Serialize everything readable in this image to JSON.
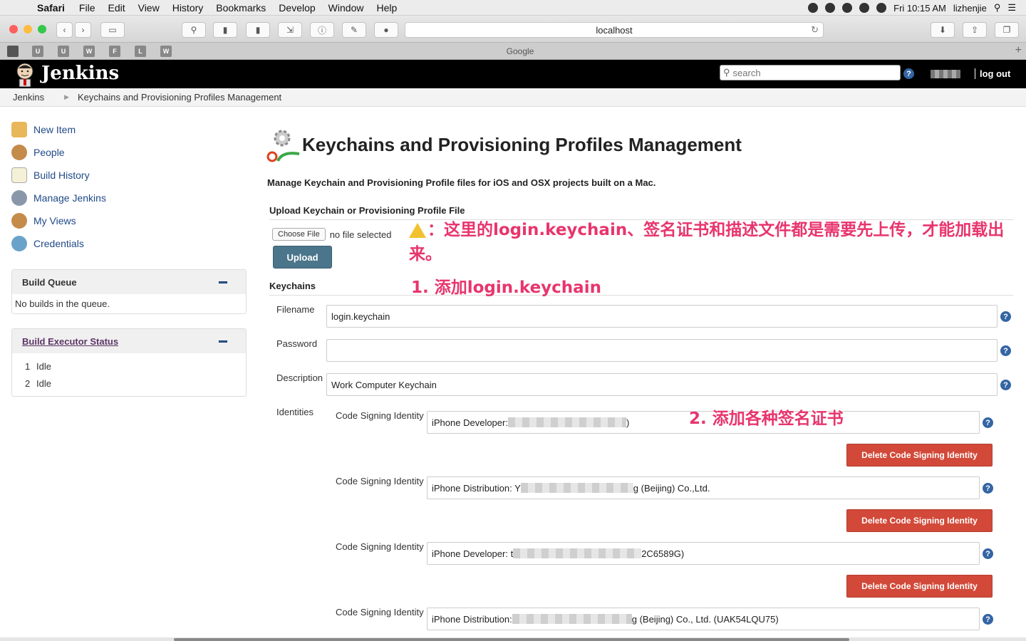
{
  "menubar": {
    "app": "Safari",
    "items": [
      "File",
      "Edit",
      "View",
      "History",
      "Bookmarks",
      "Develop",
      "Window",
      "Help"
    ],
    "clock": "Fri 10:15 AM",
    "user": "lizhenjie"
  },
  "browser": {
    "url": "localhost",
    "tab_title": "Google",
    "favorites": [
      "U",
      "U",
      "W",
      "F",
      "L",
      "W"
    ]
  },
  "jenkins": {
    "brand": "Jenkins",
    "search_placeholder": "search",
    "logout": "log out",
    "breadcrumb": [
      "Jenkins",
      "Keychains and Provisioning Profiles Management"
    ]
  },
  "sidebar": {
    "items": [
      {
        "label": "New Item",
        "icon": "new-item-icon"
      },
      {
        "label": "People",
        "icon": "people-icon"
      },
      {
        "label": "Build History",
        "icon": "build-history-icon"
      },
      {
        "label": "Manage Jenkins",
        "icon": "gear-icon"
      },
      {
        "label": "My Views",
        "icon": "my-views-icon"
      },
      {
        "label": "Credentials",
        "icon": "credentials-icon"
      }
    ],
    "build_queue": {
      "title": "Build Queue",
      "empty": "No builds in the queue."
    },
    "executors": {
      "title": "Build Executor Status",
      "rows": [
        {
          "num": "1",
          "state": "Idle"
        },
        {
          "num": "2",
          "state": "Idle"
        }
      ]
    }
  },
  "page": {
    "title": "Keychains and Provisioning Profiles Management",
    "description": "Manage Keychain and Provisioning Profile files for iOS and OSX projects built on a Mac.",
    "upload_heading": "Upload Keychain or Provisioning Profile File",
    "choose_file": "Choose File",
    "no_file": "no file selected",
    "upload_button": "Upload",
    "keychains_heading": "Keychains",
    "fields": {
      "filename_label": "Filename",
      "filename_value": "login.keychain",
      "password_label": "Password",
      "password_value": "",
      "description_label": "Description",
      "description_value": "Work Computer Keychain",
      "identities_label": "Identities"
    },
    "identities": [
      {
        "label": "Code Signing Identity",
        "prefix": "iPhone Developer: ",
        "suffix": ")",
        "delete": "Delete Code Signing Identity"
      },
      {
        "label": "Code Signing Identity",
        "prefix": "iPhone Distribution: Y",
        "suffix": "g (Beijing) Co.,Ltd.",
        "delete": "Delete Code Signing Identity"
      },
      {
        "label": "Code Signing Identity",
        "prefix": "iPhone Developer: t",
        "suffix": "2C6589G)",
        "delete": "Delete Code Signing Identity"
      },
      {
        "label": "Code Signing Identity",
        "prefix": "iPhone Distribution: ",
        "suffix": "g (Beijing) Co., Ltd. (UAK54LQU75)"
      }
    ]
  },
  "annotations": {
    "note_line1": "：这里的login.keychain、签名证书和描述文件都是需要先上传，才能加载出",
    "note_line2": "来。",
    "step1": "1. 添加login.keychain",
    "step2": "2. 添加各种签名证书"
  },
  "colors": {
    "jenkins_header": "#000000",
    "upload_button": "#4b758b",
    "delete_button": "#d24939",
    "annotation": "#e8356d",
    "link": "#204a87"
  }
}
